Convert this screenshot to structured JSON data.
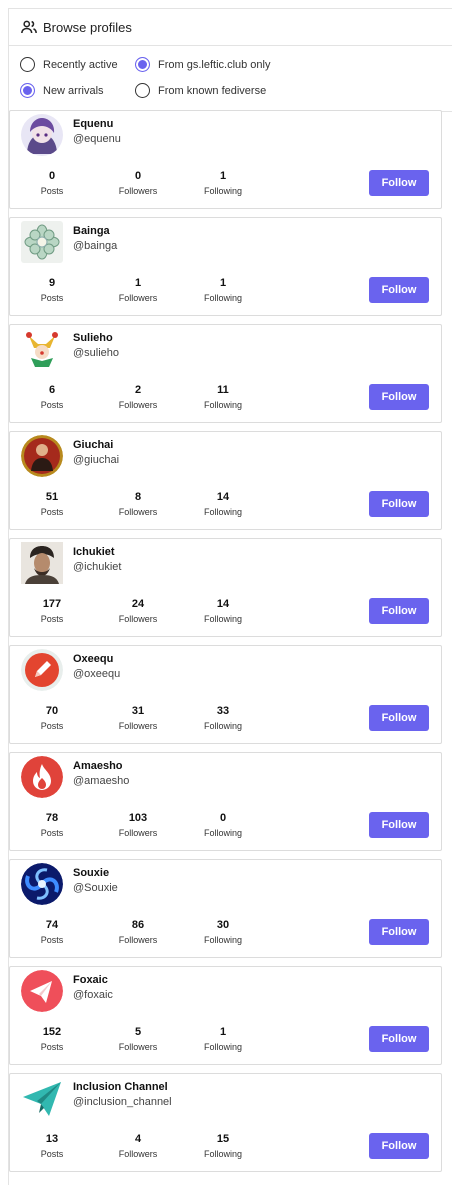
{
  "header": {
    "title": "Browse profiles",
    "icon": "people-icon"
  },
  "filters": [
    {
      "label": "Recently active",
      "checked": false
    },
    {
      "label": "From gs.leftic.club only",
      "checked": true
    },
    {
      "label": "New arrivals",
      "checked": true
    },
    {
      "label": "From known fediverse",
      "checked": false
    }
  ],
  "stat_labels": {
    "posts": "Posts",
    "followers": "Followers",
    "following": "Following"
  },
  "follow_label": "Follow",
  "accent_color": "#6a63ee",
  "profiles": [
    {
      "name": "Equenu",
      "handle": "@equenu",
      "posts": "0",
      "followers": "0",
      "following": "1",
      "avatar": "anime-avatar"
    },
    {
      "name": "Bainga",
      "handle": "@bainga",
      "posts": "9",
      "followers": "1",
      "following": "1",
      "avatar": "flower-avatar"
    },
    {
      "name": "Sulieho",
      "handle": "@sulieho",
      "posts": "6",
      "followers": "2",
      "following": "11",
      "avatar": "jester-avatar"
    },
    {
      "name": "Giuchai",
      "handle": "@giuchai",
      "posts": "51",
      "followers": "8",
      "following": "14",
      "avatar": "portrait-avatar"
    },
    {
      "name": "Ichukiet",
      "handle": "@ichukiet",
      "posts": "177",
      "followers": "24",
      "following": "14",
      "avatar": "photo-avatar"
    },
    {
      "name": "Oxeequ",
      "handle": "@oxeequ",
      "posts": "70",
      "followers": "31",
      "following": "33",
      "avatar": "pencil-avatar"
    },
    {
      "name": "Amaesho",
      "handle": "@amaesho",
      "posts": "78",
      "followers": "103",
      "following": "0",
      "avatar": "flame-avatar"
    },
    {
      "name": "Souxie",
      "handle": "@Souxie",
      "posts": "74",
      "followers": "86",
      "following": "30",
      "avatar": "vortex-avatar"
    },
    {
      "name": "Foxaic",
      "handle": "@foxaic",
      "posts": "152",
      "followers": "5",
      "following": "1",
      "avatar": "paper-plane-avatar"
    },
    {
      "name": "Inclusion Channel",
      "handle": "@inclusion_channel",
      "posts": "13",
      "followers": "4",
      "following": "15",
      "avatar": "teal-plane-avatar"
    }
  ]
}
